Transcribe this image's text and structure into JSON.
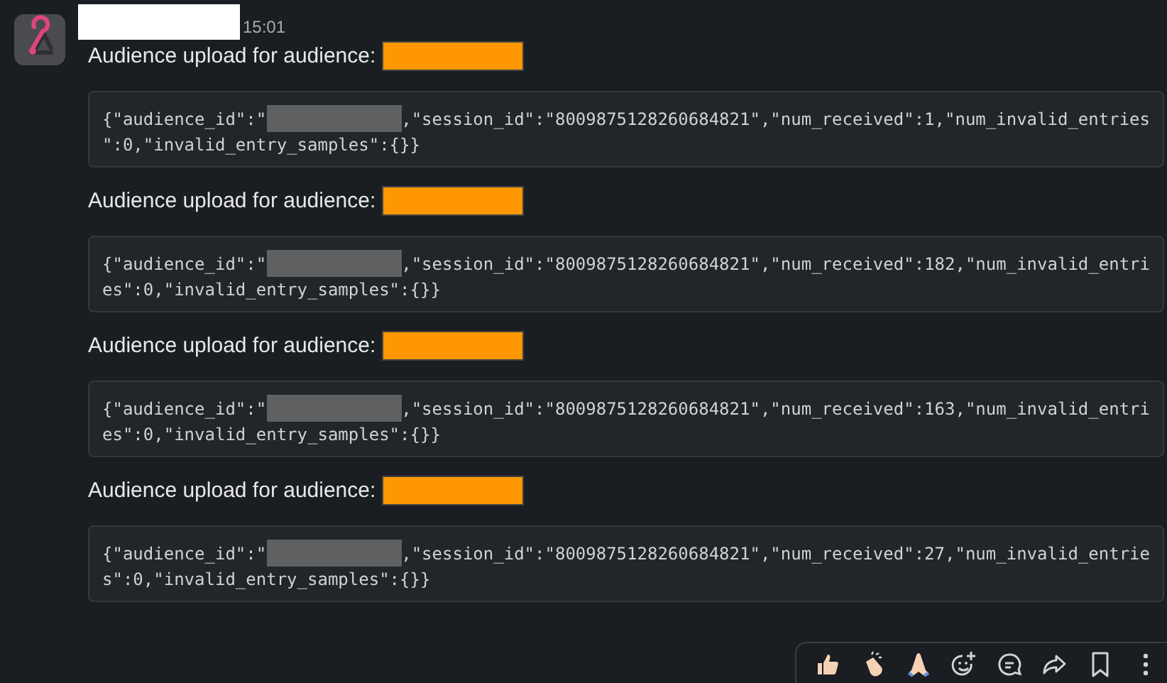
{
  "message": {
    "time": "15:01"
  },
  "posts": [
    {
      "label": "Audience upload for audience:",
      "code_lines": [
        [
          "{\"audience_id\":\"",
          ",\"session_id\":\"8009875128260684821\",\"num_received\":1,\"num_invalid_entries"
        ],
        [
          "\":0,\"invalid_entry_samples\":{}}"
        ]
      ]
    },
    {
      "label": "Audience upload for audience:",
      "code_lines": [
        [
          "{\"audience_id\":\"",
          ",\"session_id\":\"8009875128260684821\",\"num_received\":182,\"num_invalid_entri"
        ],
        [
          "es\":0,\"invalid_entry_samples\":{}}"
        ]
      ]
    },
    {
      "label": "Audience upload for audience:",
      "code_lines": [
        [
          "{\"audience_id\":\"",
          ",\"session_id\":\"8009875128260684821\",\"num_received\":163,\"num_invalid_entri"
        ],
        [
          "es\":0,\"invalid_entry_samples\":{}}"
        ]
      ]
    },
    {
      "label": "Audience upload for audience:",
      "code_lines": [
        [
          "{\"audience_id\":\"",
          ",\"session_id\":\"8009875128260684821\",\"num_received\":27,\"num_invalid_entrie"
        ],
        [
          "s\":0,\"invalid_entry_samples\":{}}"
        ]
      ]
    }
  ]
}
